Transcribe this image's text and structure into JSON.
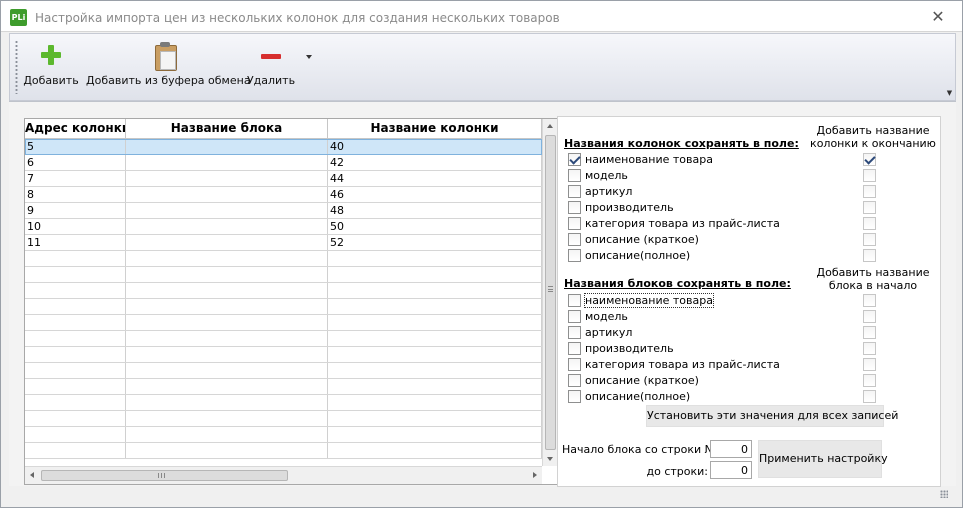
{
  "window": {
    "title": "Настройка импорта цен из нескольких колонок для создания нескольких товаров",
    "app_icon_text": "PLi",
    "close_glyph": "✕"
  },
  "toolbar": {
    "add_label": "Добавить",
    "add_clipboard_label": "Добавить из буфера обмена",
    "delete_label": "Удалить",
    "icons": {
      "add": "plus-icon",
      "clipboard": "clipboard-icon",
      "delete": "minus-icon"
    },
    "colors": {
      "add": "#5cb82e",
      "delete": "#d62e2e"
    }
  },
  "grid": {
    "columns": [
      "Адрес колонки",
      "Название блока",
      "Название колонки"
    ],
    "rows": [
      [
        "5",
        "",
        "40"
      ],
      [
        "6",
        "",
        "42"
      ],
      [
        "7",
        "",
        "44"
      ],
      [
        "8",
        "",
        "46"
      ],
      [
        "9",
        "",
        "48"
      ],
      [
        "10",
        "",
        "50"
      ],
      [
        "11",
        "",
        "52"
      ]
    ],
    "selected_row": 0,
    "empty_rows": 13,
    "selection_color": "#cfe6f8"
  },
  "columns_section": {
    "title": "Названия колонок сохранять в поле:",
    "note_line1": "Добавить название",
    "note_line2": "колонки к окончанию",
    "options": [
      {
        "label": "наименование товара",
        "checked": true,
        "right_checked": true
      },
      {
        "label": "модель",
        "checked": false,
        "right_checked": false
      },
      {
        "label": "артикул",
        "checked": false,
        "right_checked": false
      },
      {
        "label": "производитель",
        "checked": false,
        "right_checked": false
      },
      {
        "label": "категория товара из прайс-листа",
        "checked": false,
        "right_checked": false
      },
      {
        "label": "описание (краткое)",
        "checked": false,
        "right_checked": false
      },
      {
        "label": "описание(полное)",
        "checked": false,
        "right_checked": false
      }
    ]
  },
  "blocks_section": {
    "title": "Названия блоков сохранять в поле:",
    "note_line1": "Добавить название",
    "note_line2": "блока в начало",
    "options": [
      {
        "label": "наименование товара",
        "checked": false,
        "right_checked": false
      },
      {
        "label": "модель",
        "checked": false,
        "right_checked": false
      },
      {
        "label": "артикул",
        "checked": false,
        "right_checked": false
      },
      {
        "label": "производитель",
        "checked": false,
        "right_checked": false
      },
      {
        "label": "категория товара из прайс-листа",
        "checked": false,
        "right_checked": false
      },
      {
        "label": "описание (краткое)",
        "checked": false,
        "right_checked": false
      },
      {
        "label": "описание(полное)",
        "checked": false,
        "right_checked": false
      }
    ]
  },
  "actions": {
    "set_all_label": "Установить эти значения для всех записей",
    "start_label": "Начало блока со строки №:",
    "start_value": "0",
    "end_label": "до строки:",
    "end_value": "0",
    "apply_label": "Применить настройку"
  }
}
